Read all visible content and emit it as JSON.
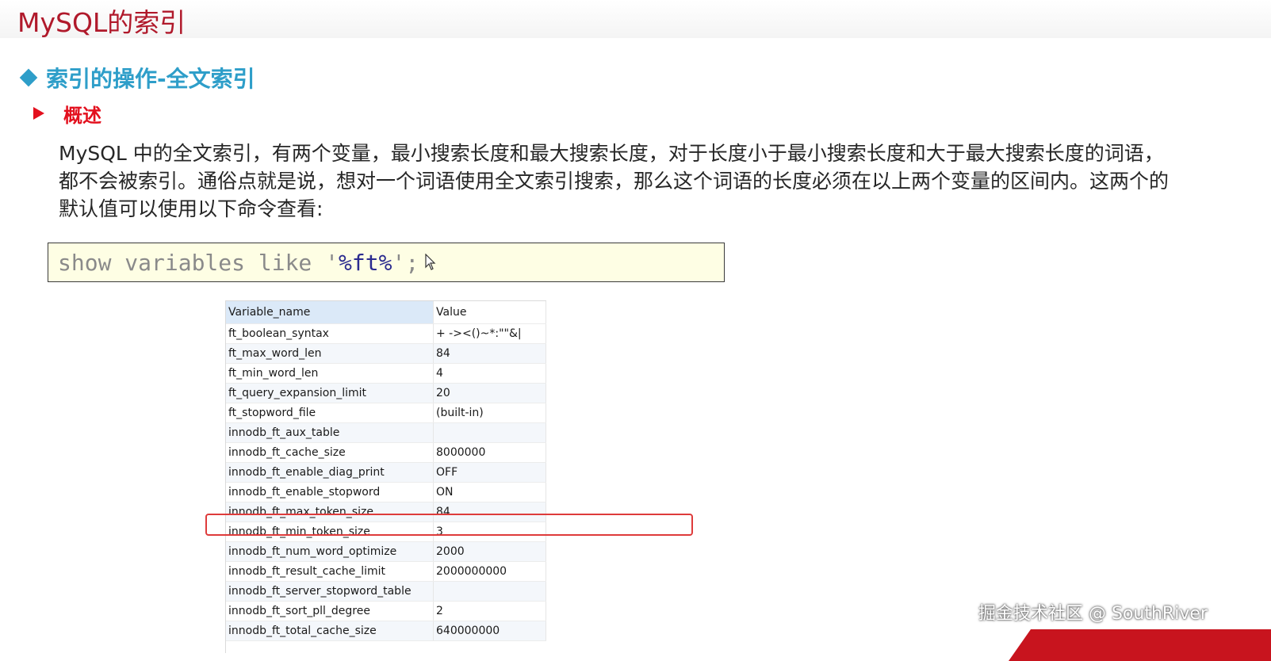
{
  "slide": {
    "title": "MySQL的索引",
    "section_title": "索引的操作-全文索引",
    "subtitle": "概述",
    "paragraph": "MySQL 中的全文索引，有两个变量，最小搜索长度和最大搜索长度，对于长度小于最小搜索长度和大于最大搜索长度的词语，都不会被索引。通俗点就是说，想对一个词语使用全文索引搜索，那么这个词语的长度必须在以上两个变量的区间内。这两个的默认值可以使用以下命令查看:"
  },
  "code": {
    "keyword": "show variables like",
    "quote_open": "'",
    "pattern": "%ft%",
    "quote_close": "'",
    "semicolon": ";"
  },
  "results": {
    "columns": [
      "Variable_name",
      "Value"
    ],
    "rows": [
      [
        "ft_boolean_syntax",
        "+ -><()~*:\"\"&|"
      ],
      [
        "ft_max_word_len",
        "84"
      ],
      [
        "ft_min_word_len",
        "4"
      ],
      [
        "ft_query_expansion_limit",
        "20"
      ],
      [
        "ft_stopword_file",
        "(built-in)"
      ],
      [
        "innodb_ft_aux_table",
        ""
      ],
      [
        "innodb_ft_cache_size",
        "8000000"
      ],
      [
        "innodb_ft_enable_diag_print",
        "OFF"
      ],
      [
        "innodb_ft_enable_stopword",
        "ON"
      ],
      [
        "innodb_ft_max_token_size",
        "84"
      ],
      [
        "innodb_ft_min_token_size",
        "3"
      ],
      [
        "innodb_ft_num_word_optimize",
        "2000"
      ],
      [
        "innodb_ft_result_cache_limit",
        "2000000000"
      ],
      [
        "innodb_ft_server_stopword_table",
        ""
      ],
      [
        "innodb_ft_sort_pll_degree",
        "2"
      ],
      [
        "innodb_ft_total_cache_size",
        "640000000"
      ]
    ],
    "highlighted_row": "innodb_ft_min_token_size"
  },
  "watermark": "掘金技术社区 @ SouthRiver",
  "colors": {
    "title": "#b0192b",
    "section": "#2e9ec9",
    "subtitle": "#e3101e",
    "highlight": "#de3b3b",
    "code_background": "#fefee4"
  }
}
